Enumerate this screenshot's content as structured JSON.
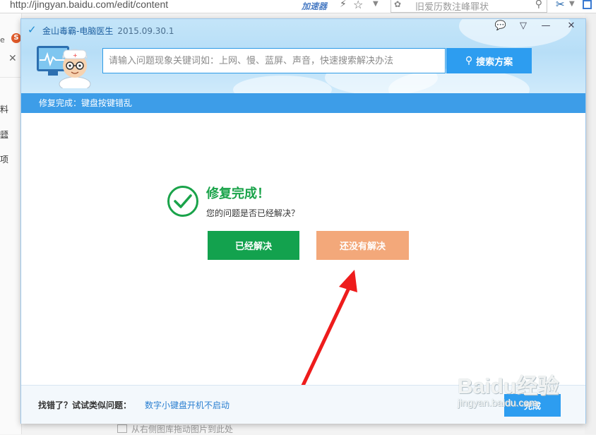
{
  "browser": {
    "url": "http://jingyan.baidu.com/edit/content",
    "accelerator_label": "加速器",
    "search_placeholder": "旧爱历数注峰罪状",
    "bottom_hint": "从右侧图库拖动图片到此处",
    "side_tab_letter": "e",
    "side_items": [
      "料",
      "瓥",
      "项"
    ]
  },
  "app": {
    "title": "金山毒霸-电脑医生",
    "version": "2015.09.30.1",
    "search": {
      "placeholder": "请输入问题现象关键词如：上网、慢、蓝屏、声音，快速搜索解决办法",
      "button_label": "搜索方案"
    },
    "status_text": "修复完成：键盘按键错乱"
  },
  "result": {
    "title": "修复完成！",
    "question": "您的问题是否已经解决？",
    "solved_label": "已经解决",
    "unsolved_label": "还没有解决"
  },
  "footer": {
    "label": "找错了？试试类似问题：",
    "link_text": "数字小键盘开机不启动",
    "done_label": "完成"
  },
  "watermark": {
    "line1": "Baidu经验",
    "line2": "jingyan.baidu.com"
  },
  "colors": {
    "accent_blue": "#2d9df0",
    "solved_green": "#13a24e",
    "unsolved_orange": "#f3a87a",
    "annotation_red": "#ee1c1c"
  }
}
